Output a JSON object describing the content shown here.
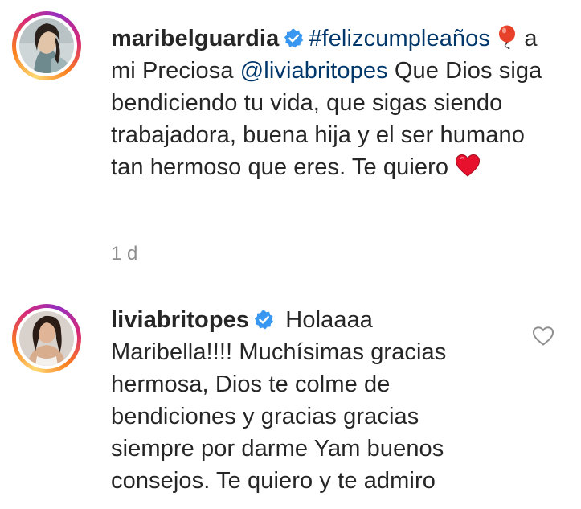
{
  "comments": [
    {
      "username": "maribelguardia",
      "verified": true,
      "hashtag": "#felizcumpleaños",
      "text_part_1": " a mi Preciosa ",
      "mention": "@liviabritopes",
      "text_part_2": " Que Dios siga bendiciendo tu vida, que sigas siendo trabajadora, buena hija y el ser humano tan hermoso que eres. Te quiero ",
      "emojis": [
        "balloon",
        "red-heart"
      ],
      "timestamp": "1 d"
    },
    {
      "username": "liviabritopes",
      "verified": true,
      "text": " Holaaaa Maribella!!!! Muchísimas gracias hermosa, Dios te colme de bendiciones y gracias gracias siempre por darme Yam buenos consejos. Te quiero y te admiro",
      "like_icon": "heart-outline-icon"
    }
  ],
  "colors": {
    "text": "#262626",
    "link": "#00376b",
    "meta": "#8e8e8e",
    "verified": "#3897f0",
    "heart": "#e8112d"
  }
}
